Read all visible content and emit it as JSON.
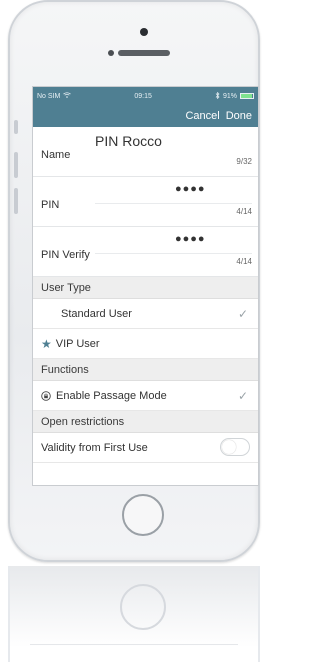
{
  "status_bar": {
    "carrier": "No SIM",
    "wifi_icon": "wifi-icon",
    "time": "09:15",
    "bluetooth_icon": "bluetooth-icon",
    "battery_percent": "91%",
    "battery_level": 0.91
  },
  "nav": {
    "cancel_label": "Cancel",
    "done_label": "Done"
  },
  "form": {
    "name": {
      "label": "Name",
      "value": "PIN Rocco",
      "count": "9/32"
    },
    "pin": {
      "label": "PIN",
      "value": "●●●●",
      "count": "4/14"
    },
    "pin_verify": {
      "label": "PIN Verify",
      "value": "●●●●",
      "count": "4/14"
    }
  },
  "user_type": {
    "header": "User Type",
    "options": [
      {
        "label": "Standard User",
        "checked": true
      },
      {
        "label": "VIP User",
        "icon": "star-icon",
        "checked": false
      }
    ]
  },
  "functions": {
    "header": "Functions",
    "passage_mode": {
      "label": "Enable Passage Mode",
      "icon": "lock-circle-icon",
      "checked": true
    }
  },
  "restrictions": {
    "header": "Open restrictions",
    "validity": {
      "label": "Validity from First Use",
      "toggle_on": false
    }
  },
  "colors": {
    "bar": "#4f7f92",
    "section_bg": "#eeeeee"
  }
}
